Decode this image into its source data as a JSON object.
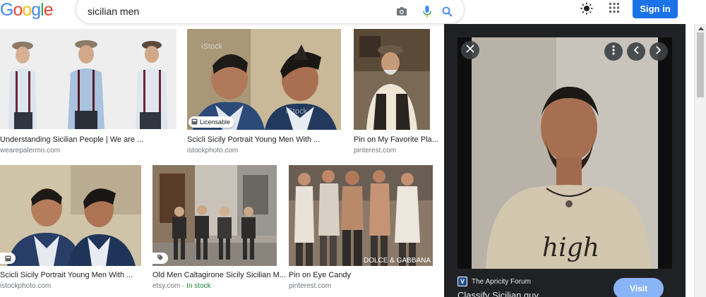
{
  "header": {
    "logo_letters": [
      "G",
      "o",
      "o",
      "g",
      "l",
      "e"
    ],
    "logo_colors": [
      "#4285f4",
      "#ea4335",
      "#fbbc05",
      "#4285f4",
      "#34a853",
      "#ea4335"
    ],
    "search_value": "sicilian men",
    "signin_label": "Sign in",
    "icons": [
      "camera-icon",
      "microphone-icon",
      "search-icon",
      "theme-icon",
      "apps-icon"
    ]
  },
  "results": [
    {
      "caption": "Understanding Sicilian People | We are ...",
      "source": "wearepalermo.com",
      "badge": ""
    },
    {
      "caption": "Scicli Sicily Portrait Young Men With ...",
      "source": "istockphoto.com",
      "badge": "Licensable"
    },
    {
      "caption": "Pin on My Favorite Pla...",
      "source": "pinterest.com",
      "badge": ""
    },
    {
      "caption": "Scicli Sicily Portrait Young Men With ...",
      "source": "istockphoto.com",
      "badge": ""
    },
    {
      "caption": "Old Men Caltagirone Sicily Sicilian M...",
      "source": "etsy.com",
      "stock": "In stock",
      "separator": " · ",
      "badge": ""
    },
    {
      "caption": "Pin on Eye Candy",
      "source": "pinterest.com",
      "badge": ""
    }
  ],
  "image_text": {
    "watermark": "iStock",
    "watermark_2": "iStock",
    "brand_overlay": "DOLCE & GABBANA"
  },
  "panel": {
    "site_name": "The Apricity Forum",
    "site_logo_letter": "V",
    "title": "Classify Sicilian guy",
    "visit_label": "Visit",
    "shirt_text": "high"
  },
  "colors": {
    "accent": "#1a73e8",
    "panel_bg": "#202124",
    "visit": "#8ab4f8",
    "in_stock": "#188038"
  }
}
